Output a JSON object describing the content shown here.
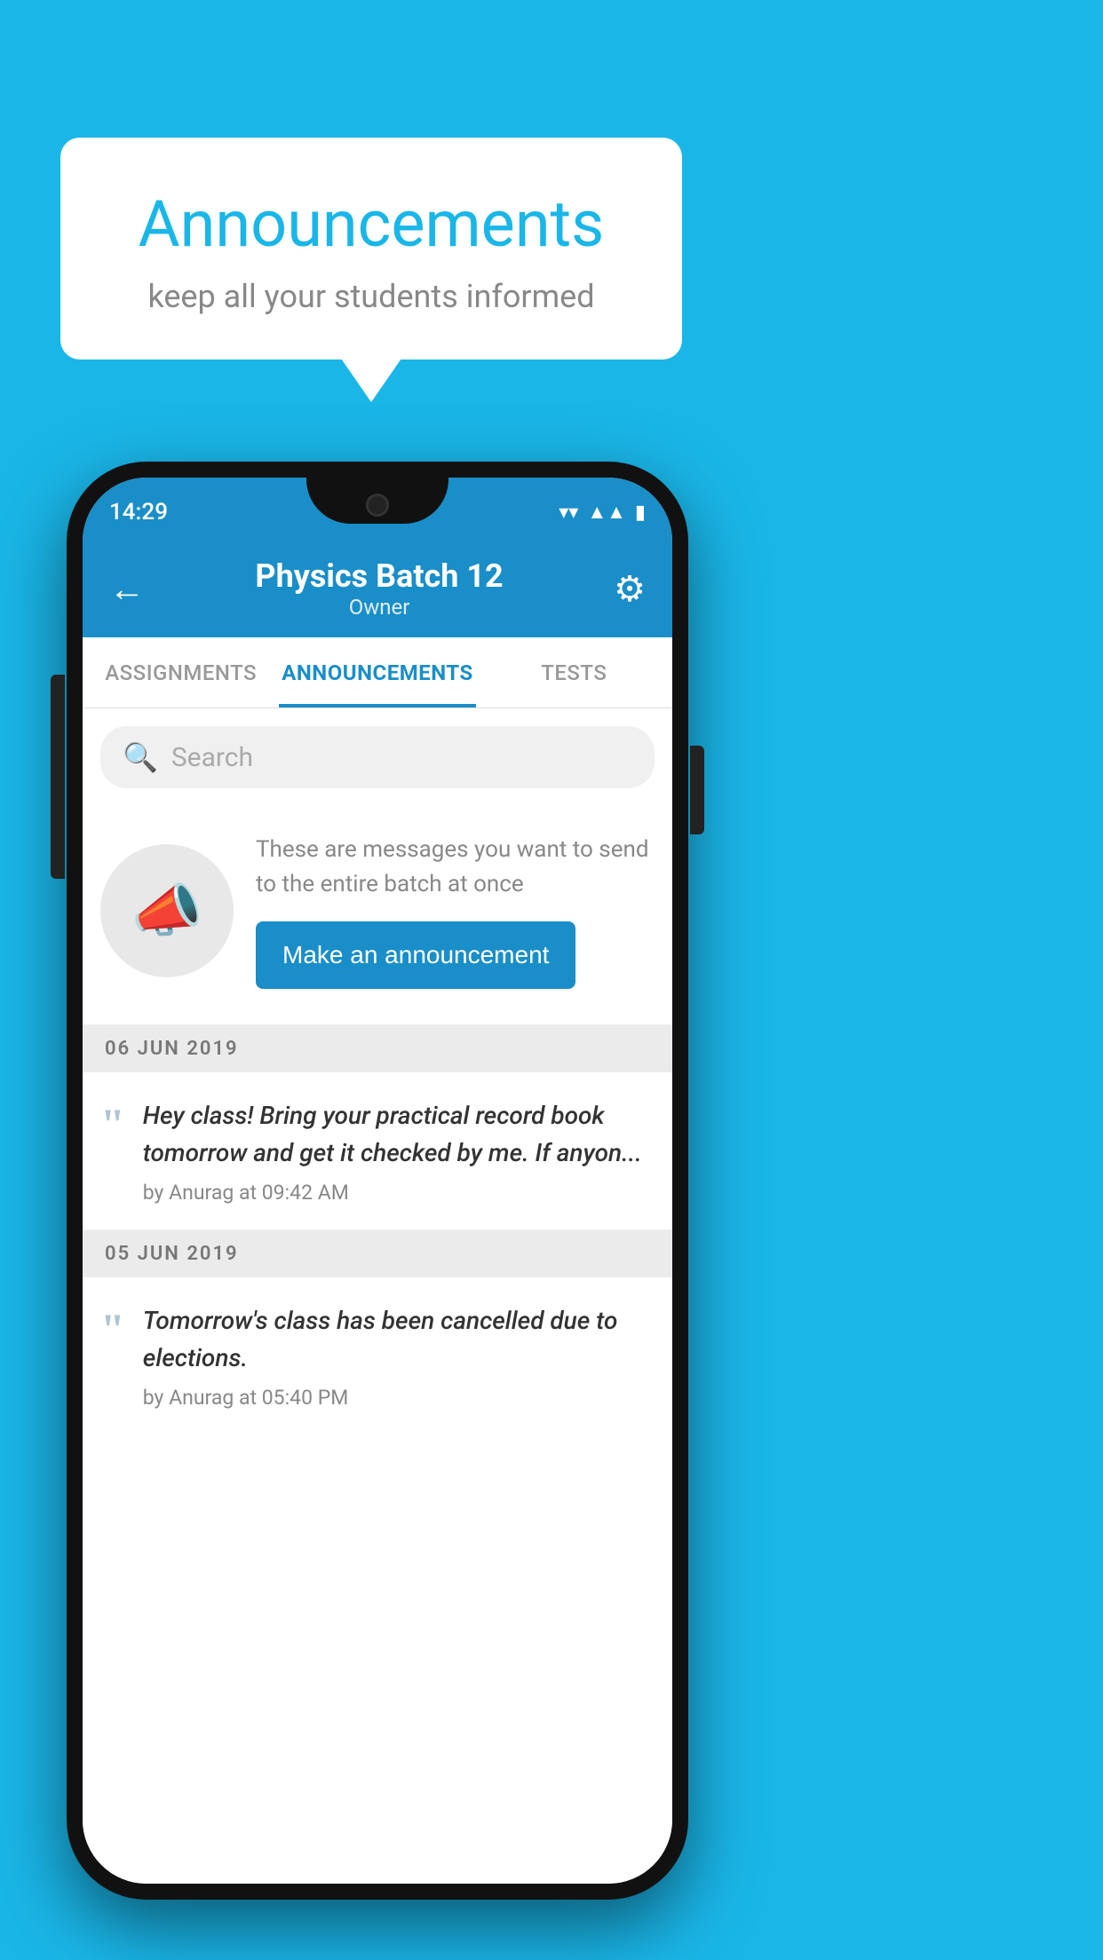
{
  "background_color": "#1ab6e8",
  "speech_bubble": {
    "title": "Announcements",
    "subtitle": "keep all your students informed"
  },
  "status_bar": {
    "time": "14:29",
    "wifi_icon": "▾",
    "signal_icon": "▲",
    "battery_icon": "▮"
  },
  "header": {
    "title": "Physics Batch 12",
    "subtitle": "Owner",
    "back_label": "←",
    "gear_label": "⚙"
  },
  "tabs": [
    {
      "label": "ASSIGNMENTS",
      "active": false
    },
    {
      "label": "ANNOUNCEMENTS",
      "active": true
    },
    {
      "label": "TESTS",
      "active": false
    }
  ],
  "search": {
    "placeholder": "Search"
  },
  "announcement_placeholder": {
    "description": "These are messages you want to send to the entire batch at once",
    "button_label": "Make an announcement"
  },
  "date_sections": [
    {
      "date": "06  JUN  2019",
      "items": [
        {
          "text": "Hey class! Bring your practical record book tomorrow and get it checked by me. If anyon...",
          "meta": "by Anurag at 09:42 AM"
        }
      ]
    },
    {
      "date": "05  JUN  2019",
      "items": [
        {
          "text": "Tomorrow's class has been cancelled due to elections.",
          "meta": "by Anurag at 05:40 PM"
        }
      ]
    }
  ]
}
